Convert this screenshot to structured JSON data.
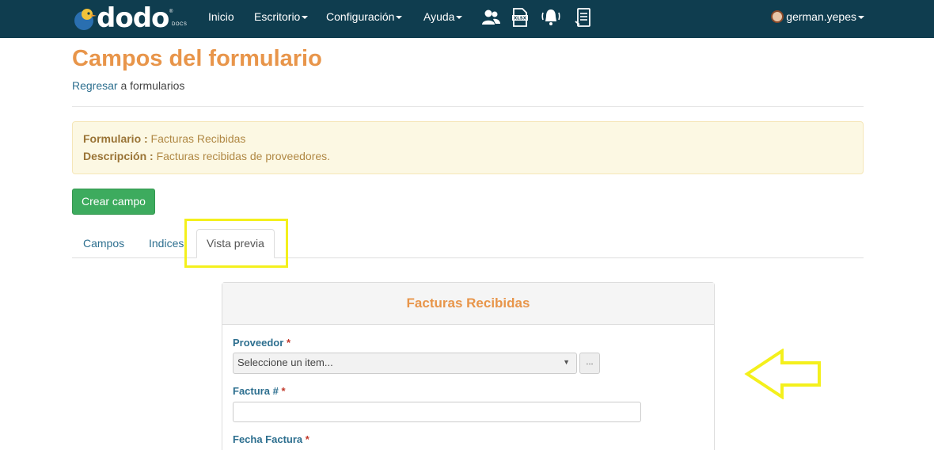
{
  "brand": {
    "name": "dodo",
    "reg": "®",
    "sub": "DOCS"
  },
  "nav": {
    "items": [
      {
        "label": "Inicio",
        "dropdown": false
      },
      {
        "label": "Escritorio",
        "dropdown": true
      },
      {
        "label": "Configuración",
        "dropdown": true
      },
      {
        "label": "Ayuda",
        "dropdown": true
      }
    ],
    "icons": [
      "users-icon",
      "xlsx-file-icon",
      "bell-alert-icon",
      "document-list-icon"
    ],
    "user": "german.yepes"
  },
  "page": {
    "title": "Campos del formulario",
    "back_link": "Regresar",
    "back_rest": " a formularios"
  },
  "info": {
    "form_label": "Formulario :",
    "form_value": " Facturas Recibidas",
    "desc_label": "Descripción :",
    "desc_value": " Facturas recibidas de proveedores."
  },
  "actions": {
    "create_field": "Crear campo"
  },
  "tabs": [
    {
      "label": "Campos",
      "active": false
    },
    {
      "label": "Indices",
      "active": false
    },
    {
      "label": "Vista previa",
      "active": true
    }
  ],
  "preview": {
    "title": "Facturas Recibidas",
    "fields": [
      {
        "label": "Proveedor",
        "required": "*",
        "type": "select",
        "value": "Seleccione un item...",
        "button": "..."
      },
      {
        "label": "Factura #",
        "required": "*",
        "type": "text",
        "value": ""
      },
      {
        "label": "Fecha Factura",
        "required": "*",
        "type": "date",
        "value": ""
      }
    ]
  },
  "colors": {
    "navbar": "#0f3d4f",
    "title": "#e8954a",
    "link": "#2d6f8f",
    "success": "#3dab5e",
    "alert_bg": "#fcf8e3",
    "annotation": "#f4f01c"
  }
}
